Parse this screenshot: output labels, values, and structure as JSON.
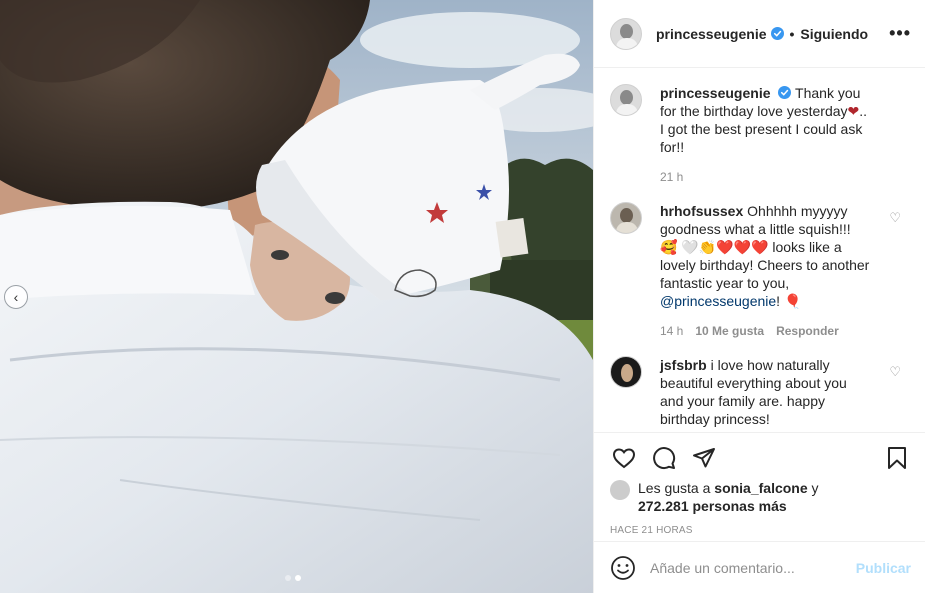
{
  "header": {
    "username": "princesseugenie",
    "separator": "•",
    "follow_status": "Siguiendo",
    "more_icon": "ellipsis-icon",
    "more_label": "•••"
  },
  "caption": {
    "username": "princesseugenie",
    "text_before": "Thank you for the birthday love yesterday",
    "emoji": "❤",
    "text_after": ".. I got the best present I could ask for!!",
    "time": "21 h"
  },
  "comments": [
    {
      "username": "hrhofsussex",
      "text": "Ohhhhh myyyyy goodness what a little squish!!! 🥰 🤍👏❤️❤️❤️ looks like a lovely birthday! Cheers to another fantastic year to you,",
      "mention": "@princesseugenie",
      "trail": "! 🎈",
      "time": "14 h",
      "likes": "10 Me gusta",
      "reply": "Responder"
    },
    {
      "username": "jsfsbrb",
      "text": "i love how naturally beautiful everything about you and your family are. happy birthday princess!"
    }
  ],
  "actions": {
    "likes_prefix": "Les gusta a",
    "liked_by": "sonia_falcone",
    "likes_conj": "y",
    "likes_count": "272.281 personas más",
    "time_ago": "HACE 21 HORAS"
  },
  "add_comment": {
    "placeholder": "Añade un comentario...",
    "publish": "Publicar"
  },
  "carousel": {
    "prev": "‹",
    "total": 2,
    "active_index": 2
  },
  "colors": {
    "verified": "#3897f0",
    "link": "#00376b",
    "publish_disabled": "#b2dffc",
    "muted": "#8e8e8e"
  }
}
